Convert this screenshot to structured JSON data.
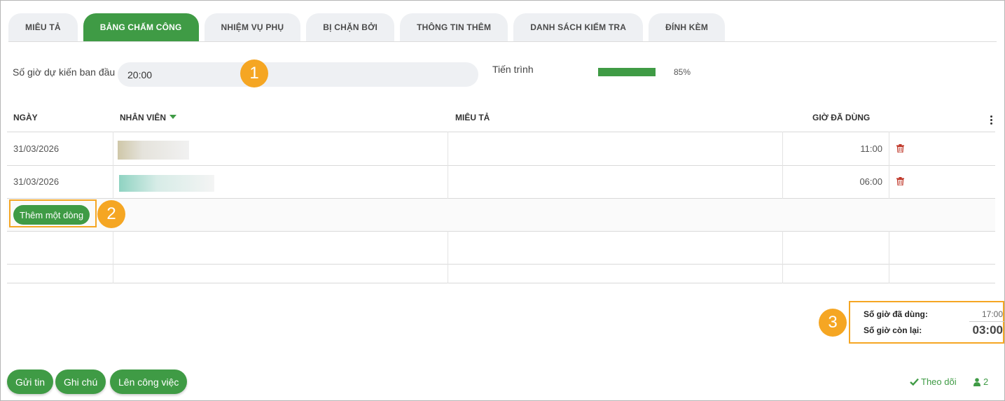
{
  "tabs": [
    {
      "label": "MIÊU TẢ",
      "active": false
    },
    {
      "label": "BẢNG CHẤM CÔNG",
      "active": true
    },
    {
      "label": "NHIỆM VỤ PHỤ",
      "active": false
    },
    {
      "label": "BỊ CHẶN BỞI",
      "active": false
    },
    {
      "label": "THÔNG TIN THÊM",
      "active": false
    },
    {
      "label": "DANH SÁCH KIỂM TRA",
      "active": false
    },
    {
      "label": "ĐÍNH KÈM",
      "active": false
    }
  ],
  "estimate": {
    "label": "Số giờ dự kiến ban đầu",
    "value": "20:00"
  },
  "progress": {
    "label": "Tiến trình",
    "percent_text": "85%",
    "fraction": 0.85
  },
  "table": {
    "columns": {
      "date": "NGÀY",
      "employee": "NHÂN VIÊN",
      "description": "MIÊU TẢ",
      "hours": "GIỜ ĐÃ DÙNG"
    },
    "rows": [
      {
        "date": "31/03/2026",
        "hours": "11:00"
      },
      {
        "date": "31/03/2026",
        "hours": "06:00"
      }
    ],
    "add_row_label": "Thêm một dòng"
  },
  "summary": {
    "used_label": "Số giờ đã dùng:",
    "used_value": "17:00",
    "remaining_label": "Số giờ còn lại:",
    "remaining_value": "03:00"
  },
  "callouts": {
    "one": "1",
    "two": "2",
    "three": "3"
  },
  "actions": {
    "send_message": "Gửi tin",
    "log_note": "Ghi chú",
    "schedule_activity": "Lên công việc"
  },
  "follow": {
    "label": "Theo dõi",
    "follower_count": "2"
  },
  "colors": {
    "primary": "#3f9b45",
    "callout": "#f5a623",
    "delete": "#c0392b"
  }
}
